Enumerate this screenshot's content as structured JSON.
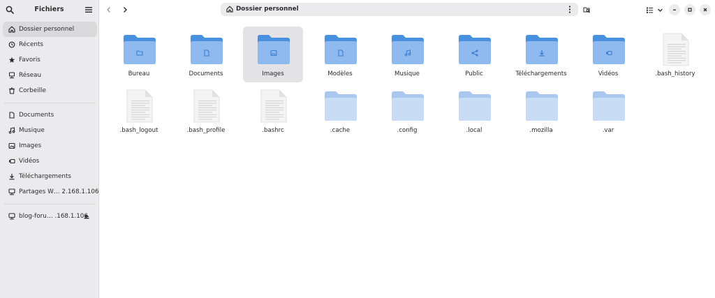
{
  "sidebar": {
    "title": "Fichiers",
    "items": [
      {
        "label": "Dossier personnel",
        "icon": "home-icon"
      },
      {
        "label": "Récents",
        "icon": "clock-icon"
      },
      {
        "label": "Favoris",
        "icon": "star-icon"
      },
      {
        "label": "Réseau",
        "icon": "network-icon"
      },
      {
        "label": "Corbeille",
        "icon": "trash-icon"
      }
    ],
    "places": [
      {
        "label": "Documents",
        "icon": "document-icon"
      },
      {
        "label": "Musique",
        "icon": "music-icon"
      },
      {
        "label": "Images",
        "icon": "image-icon"
      },
      {
        "label": "Vidéos",
        "icon": "video-icon"
      },
      {
        "label": "Téléchargements",
        "icon": "download-icon"
      },
      {
        "label": "Partages W…  2.168.1.106",
        "icon": "network-share-icon"
      }
    ],
    "mounts": [
      {
        "label": "blog-foru…  .168.1.106",
        "icon": "network-drive-icon"
      }
    ]
  },
  "header": {
    "path": "Dossier personnel"
  },
  "files": [
    {
      "name": "Bureau",
      "kind": "folder",
      "emblem": "folder"
    },
    {
      "name": "Documents",
      "kind": "folder",
      "emblem": "document"
    },
    {
      "name": "Images",
      "kind": "folder",
      "emblem": "image"
    },
    {
      "name": "Modèles",
      "kind": "folder",
      "emblem": "document"
    },
    {
      "name": "Musique",
      "kind": "folder",
      "emblem": "music"
    },
    {
      "name": "Public",
      "kind": "folder",
      "emblem": "share"
    },
    {
      "name": "Téléchargements",
      "kind": "folder",
      "emblem": "download"
    },
    {
      "name": "Vidéos",
      "kind": "folder",
      "emblem": "video"
    },
    {
      "name": ".bash_history",
      "kind": "text"
    },
    {
      "name": ".bash_logout",
      "kind": "text"
    },
    {
      "name": ".bash_profile",
      "kind": "text"
    },
    {
      "name": ".bashrc",
      "kind": "text"
    },
    {
      "name": ".cache",
      "kind": "hidden-folder"
    },
    {
      "name": ".config",
      "kind": "hidden-folder"
    },
    {
      "name": ".local",
      "kind": "hidden-folder"
    },
    {
      "name": ".mozilla",
      "kind": "hidden-folder"
    },
    {
      "name": ".var",
      "kind": "hidden-folder"
    }
  ],
  "selected_file": "Images",
  "colors": {
    "folder_back": "#4a8fe0",
    "folder_front": "#8fbaf0",
    "hidden_folder_back": "#a8c8ef",
    "hidden_folder_front": "#c9dcf6",
    "emblem": "#3c7dd4",
    "sidebar_bg": "#ebebed",
    "selection_bg": "#e3e3e5"
  }
}
